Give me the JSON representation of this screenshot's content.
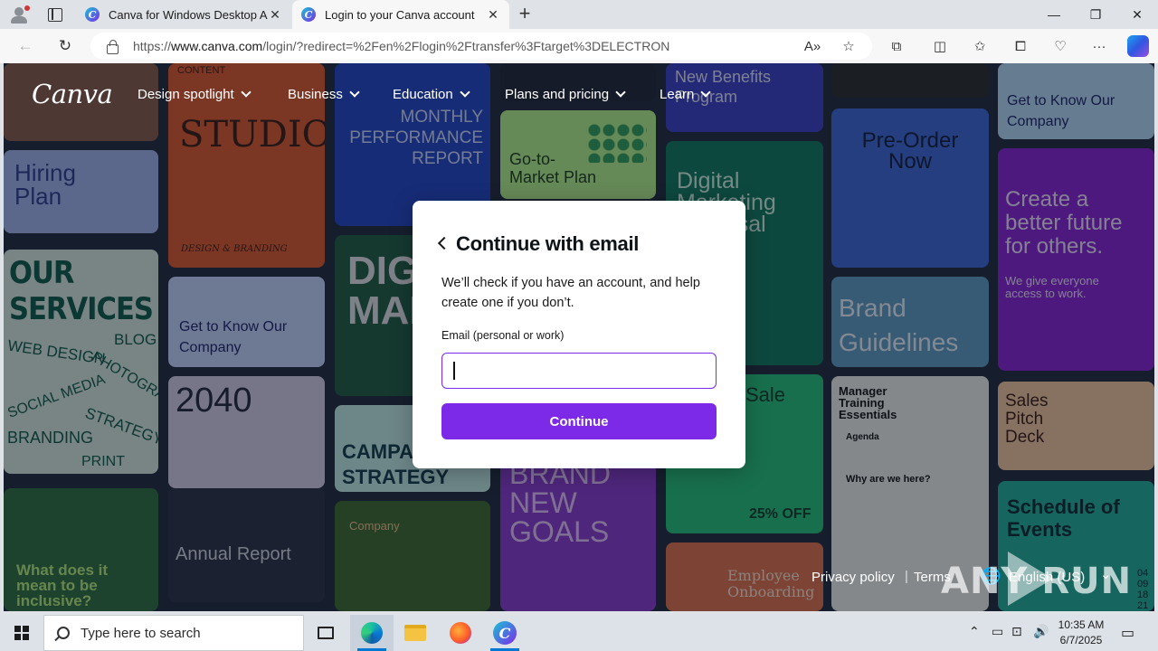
{
  "browser": {
    "tabs": [
      {
        "title": "Canva for Windows Desktop App | Free Download",
        "favicon": "canva-icon",
        "active": false
      },
      {
        "title": "Login to your Canva account",
        "favicon": "canva-icon",
        "active": true
      }
    ],
    "new_tab": "+",
    "window_controls": {
      "minimize": "—",
      "maximize": "❐",
      "close": "✕"
    },
    "url": {
      "prefix": "https://",
      "host": "www.canva.com",
      "path": "/login/?redirect=%2Fen%2Flogin%2Ftransfer%3Ftarget%3DELECTRON"
    },
    "toolbar_icons": [
      "read-aloud-icon",
      "favorite-star-icon",
      "extensions-icon",
      "split-screen-icon",
      "favorites-icon",
      "collections-icon",
      "performance-icon",
      "more-icon",
      "copilot-icon"
    ]
  },
  "page": {
    "logo": "Canva",
    "nav": [
      {
        "label": "Design spotlight"
      },
      {
        "label": "Business"
      },
      {
        "label": "Education"
      },
      {
        "label": "Plans and pricing"
      },
      {
        "label": "Learn"
      }
    ],
    "modal": {
      "title": "Continue with email",
      "description": "We’ll check if you have an account, and help create one if you don’t.",
      "email_label": "Email (personal or work)",
      "email_value": "",
      "continue_label": "Continue"
    },
    "footer": {
      "privacy": "Privacy policy",
      "separator": "|",
      "terms": "Terms",
      "language": "English (US)"
    },
    "watermark": "ANY RUN",
    "background_tiles": {
      "monthly": "MONTHLY PERFORMANCE REPORT",
      "content": "CONTENT",
      "studio": "STUDIO",
      "design_branding": "DESIGN & BRANDING",
      "new_benefits": "New Benefits Program",
      "gtm": "Go-to-Market Plan",
      "preorder": "Pre-Order Now",
      "hiring": "Hiring Plan",
      "digital": "Digital Marketing Proposal",
      "create": "Create a better future for others.",
      "create_sub": "We give everyone access to work.",
      "get_to_know_1": "Get to Know Our Company",
      "get_to_know_2": "Get to Know Our Company",
      "our_services": "OUR SERVICES",
      "services_words": [
        "BLOG",
        "WEB DESIGN",
        "PHOTOGRAPHY",
        "SOCIAL MEDIA",
        "STRATEGY",
        "BRANDING",
        "PRINT"
      ],
      "digital2": "DIGITAL MARKETING",
      "brand": "Brand Guidelines",
      "y2040": "2040",
      "annual": "Annual Report",
      "campaign": "CAMPAIGN STRATEGY",
      "sale": "Sale",
      "sale_pct": "25% OFF",
      "manager": "Manager Training Essentials",
      "agenda": "Agenda",
      "why": "Why are we here?",
      "sales_pitch": "Sales Pitch Deck",
      "brand_new": "BRAND NEW GOALS",
      "company": "Company",
      "employee": "Employee Onboarding",
      "schedule": "Schedule of Events",
      "what_does": "What does it mean to be inclusive?",
      "dates": "04 09 18 21"
    }
  },
  "taskbar": {
    "search_placeholder": "Type here to search",
    "time": "10:35 AM",
    "date": "6/7/2025",
    "apps": [
      "task-view-icon",
      "edge-icon",
      "file-explorer-icon",
      "firefox-icon",
      "canva-app-icon"
    ]
  }
}
